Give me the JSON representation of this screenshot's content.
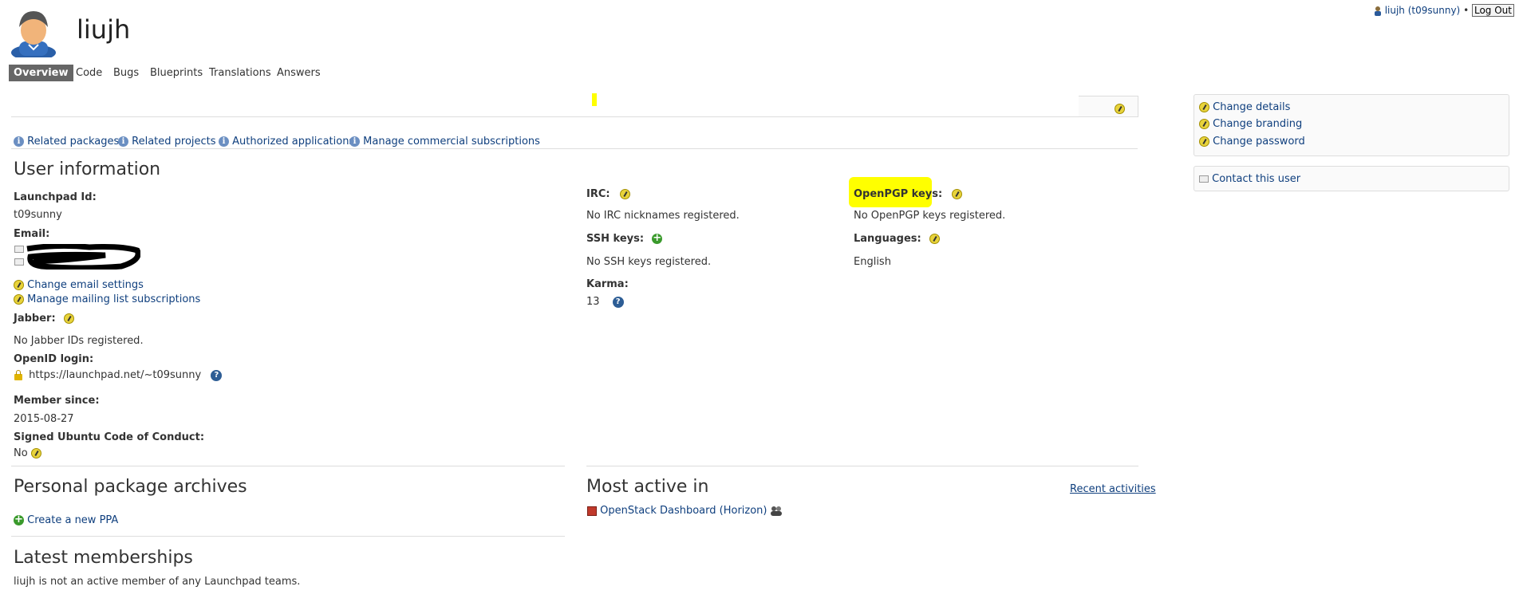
{
  "header": {
    "user_link": "liujh (t09sunny)",
    "separator": "•",
    "logout": "Log Out",
    "profile_name": "liujh"
  },
  "tabs": [
    "Overview",
    "Code",
    "Bugs",
    "Blueprints",
    "Translations",
    "Answers"
  ],
  "related_links": [
    "Related packages",
    "Related projects",
    "Authorized applications",
    "Manage commercial subscriptions"
  ],
  "user_info": {
    "title": "User information",
    "launchpad_id_label": "Launchpad Id:",
    "launchpad_id": "t09sunny",
    "email_label": "Email:",
    "change_email": "Change email settings",
    "manage_mailing": "Manage mailing list subscriptions",
    "jabber_label": "Jabber:",
    "jabber_value": "No Jabber IDs registered.",
    "openid_label": "OpenID login:",
    "openid_value": "https://launchpad.net/~t09sunny",
    "member_since_label": "Member since:",
    "member_since": "2015-08-27",
    "coc_label": "Signed Ubuntu Code of Conduct:",
    "coc_value": "No",
    "irc_label": "IRC:",
    "irc_value": "No IRC nicknames registered.",
    "ssh_label": "SSH keys:",
    "ssh_value": "No SSH keys registered.",
    "karma_label": "Karma:",
    "karma_value": "13",
    "pgp_label": "OpenPGP keys:",
    "pgp_value": "No OpenPGP keys registered.",
    "languages_label": "Languages:",
    "languages_value": "English"
  },
  "ppa": {
    "title": "Personal package archives",
    "create": "Create a new PPA"
  },
  "memberships": {
    "title": "Latest memberships",
    "text": "liujh is not an active member of any Launchpad teams."
  },
  "most_active": {
    "title": "Most active in",
    "recent": "Recent activities",
    "project": "OpenStack Dashboard (Horizon)"
  },
  "sidebar": {
    "actions": [
      "Change details",
      "Change branding",
      "Change password"
    ],
    "contact": "Contact this user"
  },
  "colors": {
    "highlight": "#ffff00",
    "link": "#0f3f7e"
  }
}
